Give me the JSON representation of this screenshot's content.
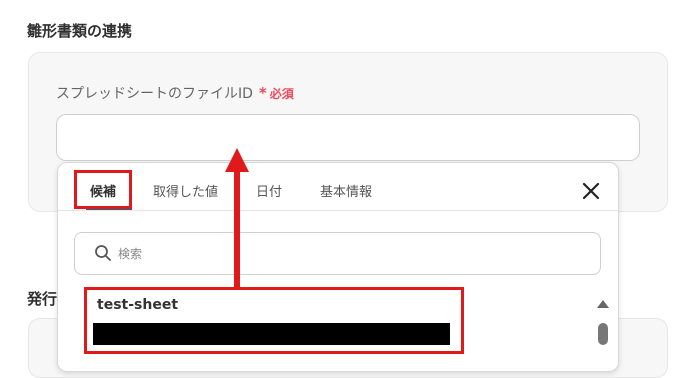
{
  "section_title": "雛形書類の連携",
  "field": {
    "label": "スプレッドシートのファイルID",
    "required_mark": "*",
    "required_text": "必須",
    "value": ""
  },
  "next_section_title": "発行",
  "dropdown": {
    "tabs": [
      {
        "label": "候補",
        "active": true
      },
      {
        "label": "取得した値",
        "active": false
      },
      {
        "label": "日付",
        "active": false
      },
      {
        "label": "基本情報",
        "active": false
      }
    ],
    "close_icon": "close-icon",
    "search": {
      "placeholder": "検索",
      "icon": "search-icon"
    },
    "options": [
      {
        "label": "test-sheet",
        "sublabel_redacted": true
      }
    ]
  },
  "colors": {
    "accent": "#1e6a8c",
    "required": "#f04a5f",
    "highlight": "#e0191b"
  }
}
